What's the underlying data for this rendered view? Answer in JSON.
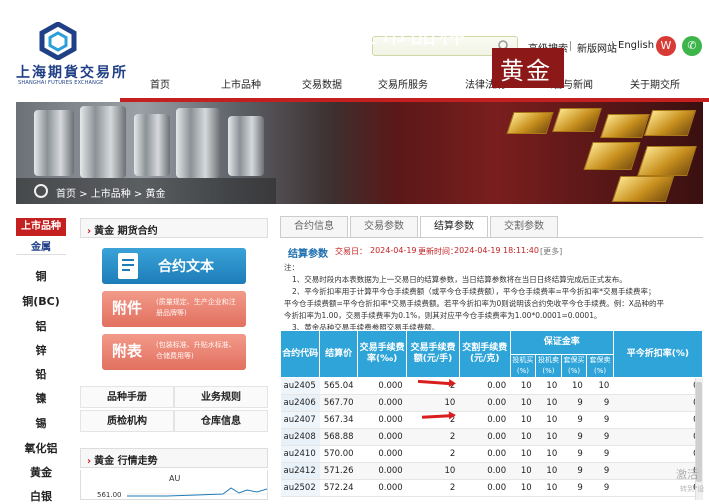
{
  "header": {
    "logo_text": "上海期貨交易所",
    "logo_sub": "SHANGHAI FUTURES EXCHANGE",
    "search": {
      "placeholder": ""
    },
    "links": [
      "高级搜索",
      "新版网站",
      "English"
    ],
    "nav": [
      "首页",
      "上市品种",
      "交易数据",
      "交易所服务",
      "法律法规",
      "公告与新闻",
      "关于期交所"
    ]
  },
  "banner": {
    "title": "上市品种",
    "subtitle": "黄金",
    "breadcrumb": "首页 > 上市品种 > 黄金"
  },
  "sidebar": {
    "head": "上市品种",
    "sub": "金属",
    "items": [
      "铜",
      "铜(BC)",
      "铝",
      "锌",
      "铅",
      "镍",
      "锡",
      "氧化铝",
      "黄金",
      "白银"
    ]
  },
  "middle": {
    "contract_title": "黄金 期货合约",
    "contract_btn": "合约文本",
    "attach_big": "附件",
    "attach_small": "(质量规定、生产企业和注册品牌等)",
    "appendix_big": "附表",
    "appendix_small": "(包装标准、升贴水标准、仓储费用等)",
    "grid": [
      "品种手册",
      "业务规则",
      "质检机构",
      "仓库信息"
    ],
    "trend_title": "黄金 行情走势",
    "trend_symbol": "AU",
    "trend_tick": "561.00"
  },
  "content": {
    "tabs": [
      "合约信息",
      "交易参数",
      "结算参数",
      "交割参数"
    ],
    "active_tab": 2,
    "settle_title": "结算参数",
    "trade_date_label": "交易日：",
    "trade_date": "2024-04-19",
    "update_label": "更新时间：",
    "update_time": "2024-04-19 18:11:40",
    "more": "[更多]",
    "notes": [
      "注：",
      "1、交易时段内本表数据为上一交易日的结算参数，当日结算参数将在当日日终结算完成后正式发布。",
      "2、平今折扣率用于计算平今仓手续费额（或平今仓手续费额），平今仓手续费率=平今折扣率*交易手续费率；",
      "平今仓手续费额=平今仓折扣率*交易手续费额。若平今折扣率为0则说明该合约免收平今仓手续费。例：X品种的平",
      "今折扣率为1.00，交易手续费率为0.1%，则其对应平今仓手续费率为1.00*0.0001=0.0001。",
      "3、黄金品种交易手续费参照交易手续费额。"
    ],
    "table": {
      "headers": {
        "code": "合约代码",
        "settle": "结算价",
        "fee_rate": "交易手续费率(‰)",
        "fee_amt": "交易手续费额(元/手)",
        "deliv_fee": "交割手续费(元/克)",
        "margin": "保证金率",
        "margin_sub": [
          "投机买(%)",
          "投机卖(%)",
          "套保买(%)",
          "套保卖(%)"
        ],
        "close_today": "平今折扣率(%)"
      },
      "rows": [
        [
          "au2405",
          "565.04",
          "0.000",
          "2",
          "0.00",
          "10",
          "10",
          "10",
          "10",
          "0"
        ],
        [
          "au2406",
          "567.70",
          "0.000",
          "10",
          "0.00",
          "10",
          "10",
          "9",
          "9",
          "0"
        ],
        [
          "au2407",
          "567.34",
          "0.000",
          "2",
          "0.00",
          "10",
          "10",
          "9",
          "9",
          "0"
        ],
        [
          "au2408",
          "568.88",
          "0.000",
          "2",
          "0.00",
          "10",
          "10",
          "9",
          "9",
          "0"
        ],
        [
          "au2410",
          "570.00",
          "0.000",
          "2",
          "0.00",
          "10",
          "10",
          "9",
          "9",
          "0"
        ],
        [
          "au2412",
          "571.26",
          "0.000",
          "10",
          "0.00",
          "10",
          "10",
          "9",
          "9",
          "0"
        ],
        [
          "au2502",
          "572.24",
          "0.000",
          "2",
          "0.00",
          "10",
          "10",
          "9",
          "9",
          "0"
        ]
      ]
    }
  },
  "watermark": "激活",
  "watermark_sub": "转到\"设"
}
